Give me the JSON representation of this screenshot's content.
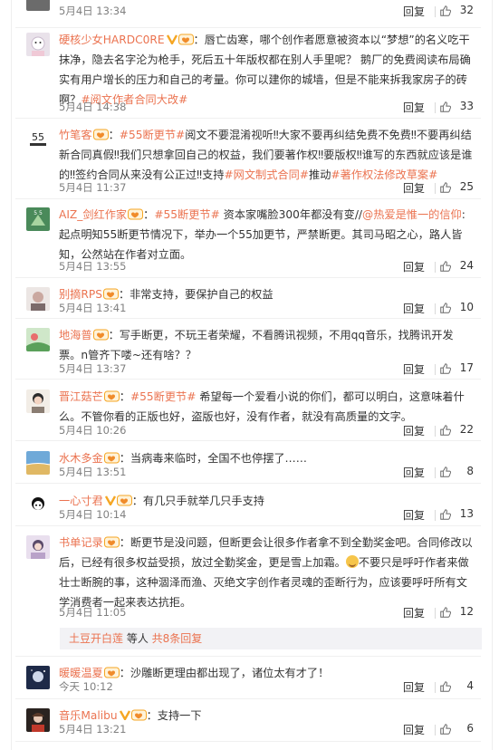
{
  "comments": [
    {
      "id": "c0",
      "time": "5月4日 13:34",
      "reply": "回复",
      "likes": "32"
    },
    {
      "id": "c1",
      "name": "硬核少女HARDC0RE",
      "text": "：唇亡齿寒，哪个创作者愿意被资本以“梦想”的名义吃干抹净，隐去名字沦为枪手，死后五十年版权都在别人手里呢？ 鹅厂的免费阅读布局确实有用户增长的压力和自己的考量。你可以建你的城墙，但是不能来拆我家房子的砖啊？",
      "tag": "#阅文作者合同大改#",
      "time": "5月4日 14:38",
      "reply": "回复",
      "likes": "33"
    },
    {
      "id": "c2",
      "name": "竹笔客",
      "tag1": "#55断更节#",
      "text": "阅文不要混淆视听‼大家不要再纠结免费不免费‼不要再纠结新合同真假‼我们只想拿回自己的权益，我们要著作权‼要版权‼谁写的东西就应该是谁的‼签约合同从来没有公正过‼支持",
      "tag2": "#网文制式合同#",
      "mid": "推动",
      "tag3": "#著作权法修改草案#",
      "time": "5月4日 11:37",
      "reply": "回复",
      "likes": "25"
    },
    {
      "id": "c3",
      "name": "AIZ_剑红作家",
      "tag1": "#55断更节#",
      "text1": " 资本家嘴脸300年都没有变//",
      "mention": "@热爱是惟一的信仰",
      "text2": ":起点明知55断更节情况下，举办一个55加更节，严禁断更。其司马昭之心，路人皆知，公然站在作者对立面。",
      "time": "5月4日 13:55",
      "reply": "回复",
      "likes": "24"
    },
    {
      "id": "c4",
      "name": "别摘RPS",
      "text": "：非常支持，要保护自己的权益",
      "time": "5月4日 13:41",
      "reply": "回复",
      "likes": "10"
    },
    {
      "id": "c5",
      "name": "地海普",
      "text": "：写手断更，不玩王者荣耀，不看腾讯视频，不用qq音乐，找腾讯开发票。n管齐下喽~还有啥？？",
      "time": "5月4日 13:37",
      "reply": "回复",
      "likes": "17"
    },
    {
      "id": "c6",
      "name": "晋江菇芒",
      "tag1": "#55断更节#",
      "text": " 希望每一个爱看小说的你们，都可以明白，这意味着什么。不管你看的正版也好，盗版也好，没有作者，就没有高质量的文字。",
      "time": "5月4日 10:26",
      "reply": "回复",
      "likes": "22"
    },
    {
      "id": "c7",
      "name": "水木多金",
      "text": "：当病毒来临时，全国不也停摆了……",
      "time": "5月4日 13:51",
      "reply": "回复",
      "likes": "8"
    },
    {
      "id": "c8",
      "name": "一心寸君",
      "text": "：有几只手就举几只手支持",
      "time": "5月4日 10:14",
      "reply": "回复",
      "likes": "13"
    },
    {
      "id": "c9",
      "name": "书单记录",
      "text1": "：断更节是没问题，但断更会让很多作者拿不到全勤奖金吧。合同修改以后，已经有很多权益受损，放过全勤奖金，更是雪上加霜。",
      "text2": "不要只是呼吁作者来做壮士断腕的事，这种涸泽而渔、灭绝文字创作者灵魂的歪断行为，应该要呼吁所有文学消费者一起来表达抗拒。",
      "time": "5月4日 11:05",
      "reply": "回复",
      "likes": "12"
    },
    {
      "id": "c10",
      "name": "暖暖温夏",
      "text": "：沙雕断更理由都出现了，诸位太有才了！",
      "time": "今天 10:12",
      "reply": "回复",
      "likes": "4"
    },
    {
      "id": "c11",
      "name": "音乐Malibu",
      "text": "：支持一下",
      "time": "5月4日 13:21",
      "reply": "回复",
      "likes": "6"
    }
  ],
  "subreplies": {
    "user": "土豆开白莲",
    "mid": " 等人 ",
    "total": "共8条回复"
  },
  "colors": {
    "accent": "#eb7350",
    "meta": "#808080",
    "vip": "#f5a623"
  }
}
